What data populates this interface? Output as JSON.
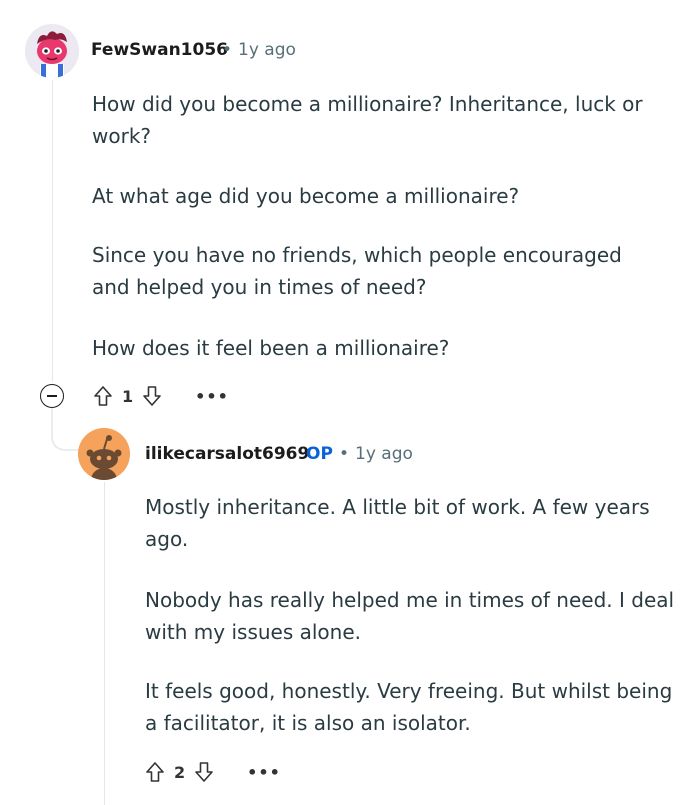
{
  "comment": {
    "username": "FewSwan1056",
    "time": "1y ago",
    "paragraphs": [
      "How did you become a millionaire? Inheritance, luck or work?",
      "At what age did you become a millionaire?",
      "Since you have no friends, which people encouraged and helped you in times of need?",
      "How does it feel been a millionaire?"
    ],
    "score": "1",
    "more": "•••"
  },
  "reply": {
    "username": "ilikecarsalot6969",
    "op_badge": "OP",
    "time": "1y ago",
    "paragraphs": [
      "Mostly inheritance. A little bit of work. A few years ago.",
      "Nobody has really helped me in times of need. I deal with my issues alone.",
      "It feels good, honestly. Very freeing. But whilst being a facilitator, it is also an isolator."
    ],
    "score": "2",
    "more": "•••"
  },
  "colors": {
    "op_blue": "#0a63d6",
    "meta_gray": "#576f76",
    "text": "#2a3c42",
    "avatar_orange": "#f5a25c"
  },
  "icons": [
    "upvote-icon",
    "downvote-icon",
    "more-icon",
    "collapse-icon",
    "snoo-avatar-icon"
  ]
}
